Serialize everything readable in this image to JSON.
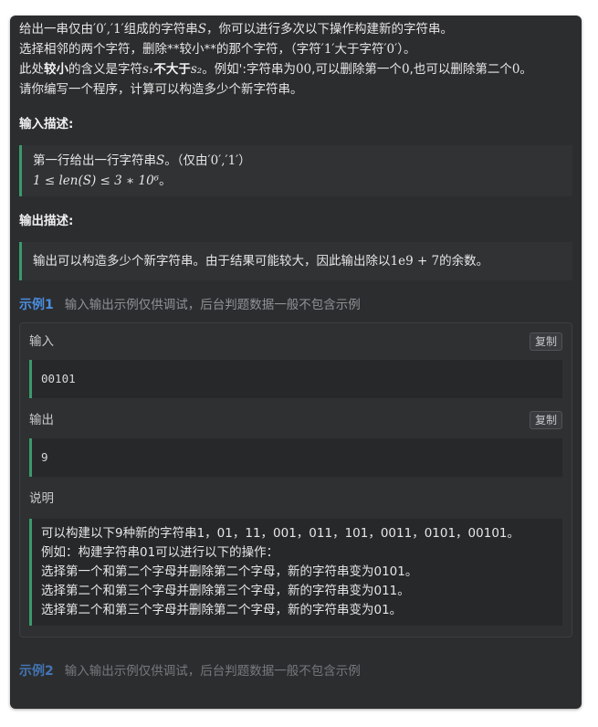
{
  "problem": {
    "desc": {
      "l1a": "给出一串仅由",
      "l1m1": "′0′,′1′",
      "l1b": "组成的字符串",
      "l1m2": "S",
      "l1c": "，你可以进行多次以下操作构建新的字符串。",
      "l2a": "选择相邻的两个字符，删除**较小**的那个字符，（字符",
      "l2m1": "′1′",
      "l2b": "大于字符",
      "l2m2": "′0′",
      "l2c": "）。",
      "l3a": "此处",
      "l3b": "较小",
      "l3c": "的含义是字符",
      "l3m1": "s₁",
      "l3d": "不大于",
      "l3m2": "s₂",
      "l3e": "。例如':字符串为",
      "l3m3": "00",
      "l3f": ",可以删除第一个",
      "l3m4": "0",
      "l3g": ",也可以删除第二个",
      "l3m5": "0",
      "l3h": "。",
      "l4": "请你编写一个程序，计算可以构造多少个新字符串。"
    },
    "input_title": "输入描述:",
    "input": {
      "l1a": "第一行给出一行字符串",
      "l1m": "S",
      "l1b": "。（仅由",
      "l1m2": "′0′,′1′",
      "l1c": "）",
      "l2m": "1 ≤ len(S) ≤ 3 ∗ 10⁶",
      "l2b": "。"
    },
    "output_title": "输出描述:",
    "output": {
      "a": "输出可以构造多少个新字符串。由于结果可能较大，因此输出除以",
      "m": "1e9 + 7",
      "b": "的余数。"
    }
  },
  "example1": {
    "title": "示例1",
    "hint": "输入输出示例仅供调试，后台判题数据一般不包含示例",
    "input_label": "输入",
    "output_label": "输出",
    "explain_label": "说明",
    "copy_label": "复制",
    "input_value": "00101",
    "output_value": "9",
    "explain": [
      "可以构建以下9种新的字符串1，01，11，001，011，101，0011，0101，00101。",
      "例如：构建字符串01可以进行以下的操作：",
      "选择第一个和第二个字母并删除第二个字母，新的字符串变为0101。",
      "选择第二个和第三个字母并删除第三个字母，新的字符串变为011。",
      "选择第二个和第三个字母并删除第二个字母，新的字符串变为01。"
    ]
  },
  "example2": {
    "title": "示例2",
    "hint": "输入输出示例仅供调试，后台判题数据一般不包含示例"
  }
}
